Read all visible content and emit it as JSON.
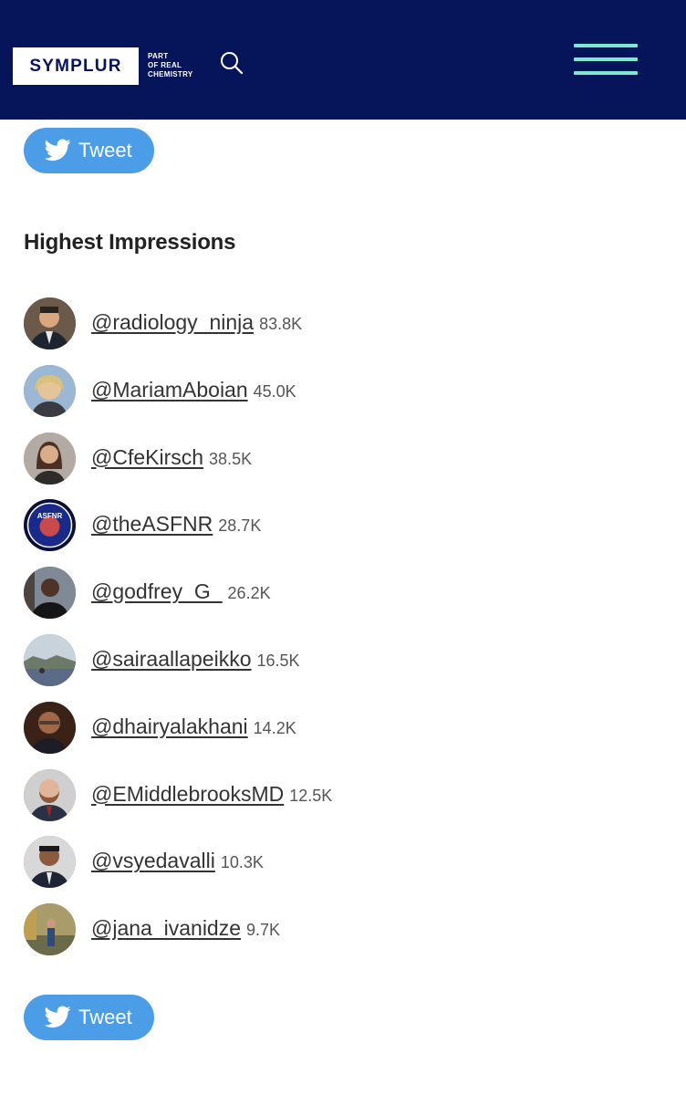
{
  "header": {
    "logo_text": "SYMPLUR",
    "tagline": [
      "PART",
      "OF REAL",
      "CHEMISTRY"
    ],
    "bg_color": "#061459",
    "accent_color": "#7ee8cf",
    "search_icon": "search-icon",
    "menu_icon": "hamburger-menu-icon"
  },
  "tweet_top": {
    "label": "Tweet",
    "icon": "twitter-bird-icon",
    "color": "#4a9de6"
  },
  "section": {
    "title": "Highest Impressions"
  },
  "impressions": [
    {
      "handle": "@radiology_ninja",
      "count": "83.8K"
    },
    {
      "handle": "@MariamAboian",
      "count": "45.0K"
    },
    {
      "handle": "@CfeKirsch",
      "count": "38.5K"
    },
    {
      "handle": "@theASFNR",
      "count": "28.7K"
    },
    {
      "handle": "@godfrey_G_",
      "count": "26.2K"
    },
    {
      "handle": "@sairaallapeikko",
      "count": "16.5K"
    },
    {
      "handle": "@dhairyalakhani",
      "count": "14.2K"
    },
    {
      "handle": "@EMiddlebrooksMD",
      "count": "12.5K"
    },
    {
      "handle": "@vsyedavalli",
      "count": "10.3K"
    },
    {
      "handle": "@jana_ivanidze",
      "count": "9.7K"
    }
  ],
  "tweet_bottom": {
    "label": "Tweet",
    "icon": "twitter-bird-icon"
  }
}
